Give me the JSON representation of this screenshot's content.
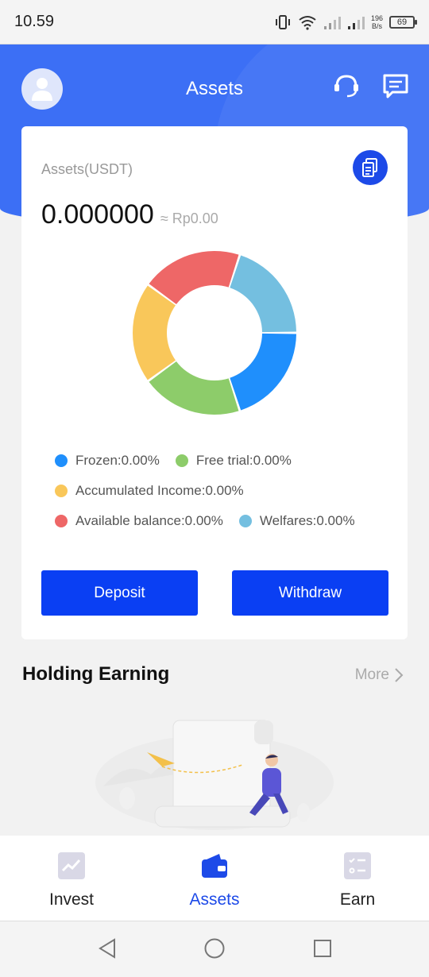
{
  "status_bar": {
    "time": "10.59",
    "speed_value": "196",
    "speed_unit": "B/s",
    "battery": "69"
  },
  "header": {
    "title": "Assets"
  },
  "assets_card": {
    "label": "Assets(USDT)",
    "balance": "0.000000",
    "fiat_value": "≈ Rp0.00",
    "chart_segments": [
      {
        "name": "Frozen",
        "color": "#1f8ffc"
      },
      {
        "name": "Free trial",
        "color": "#8dcc6a"
      },
      {
        "name": "Accumulated Income",
        "color": "#f9c75a"
      },
      {
        "name": "Available balance",
        "color": "#ee6767"
      },
      {
        "name": "Welfares",
        "color": "#74bfe0"
      }
    ],
    "legend": [
      {
        "text": "Frozen:0.00%",
        "color": "#1f8ffc"
      },
      {
        "text": "Free trial:0.00%",
        "color": "#8dcc6a"
      },
      {
        "text": "Accumulated Income:0.00%",
        "color": "#f9c75a"
      },
      {
        "text": "Available balance:0.00%",
        "color": "#ee6767"
      },
      {
        "text": "Welfares:0.00%",
        "color": "#74bfe0"
      }
    ],
    "deposit_label": "Deposit",
    "withdraw_label": "Withdraw"
  },
  "holding": {
    "title": "Holding Earning",
    "more_label": "More"
  },
  "bottom_nav": {
    "items": [
      {
        "label": "Invest",
        "icon": "chart-icon"
      },
      {
        "label": "Assets",
        "icon": "wallet-icon"
      },
      {
        "label": "Earn",
        "icon": "checklist-icon"
      }
    ],
    "active": "Assets"
  },
  "colors": {
    "primary": "#0a3ff3",
    "header": "#3c6ff5"
  }
}
